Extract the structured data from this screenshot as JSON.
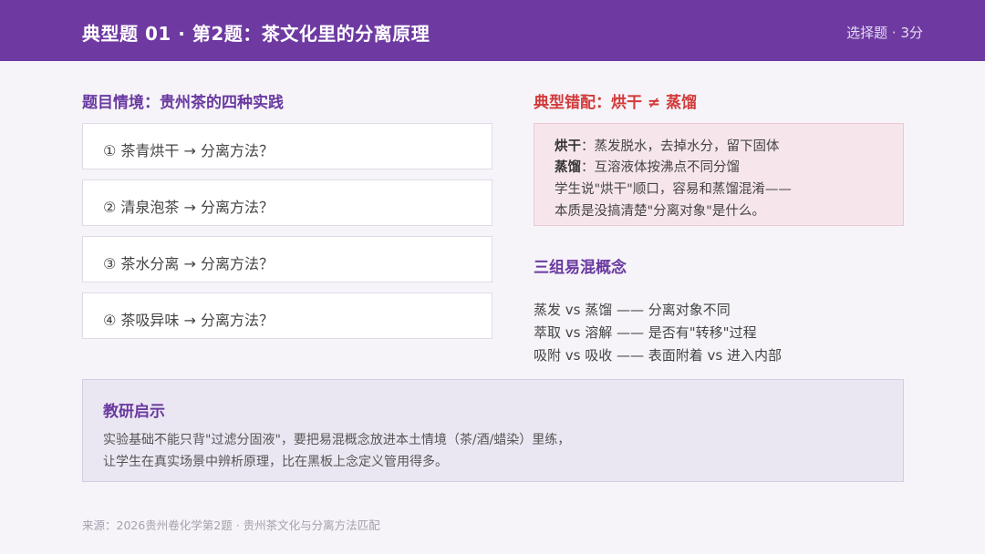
{
  "header": {
    "title": "典型题 01 · 第2题：茶文化里的分离原理",
    "meta": "选择题 · 3分"
  },
  "scenario": {
    "title": "题目情境：贵州茶的四种实践",
    "questions": [
      "① 茶青烘干 → 分离方法？",
      "② 清泉泡茶 → 分离方法？",
      "③ 茶水分离 → 分离方法？",
      "④ 茶吸异味 → 分离方法？"
    ]
  },
  "mismatch": {
    "title": "典型错配：烘干 ≠ 蒸馏",
    "lines": [
      {
        "term": "烘干",
        "text": "：蒸发脱水，去掉水分，留下固体"
      },
      {
        "term": "蒸馏",
        "text": "：互溶液体按沸点不同分馏"
      },
      {
        "term": "",
        "text": "学生说\"烘干\"顺口，容易和蒸馏混淆——"
      },
      {
        "term": "",
        "text": "本质是没搞清楚\"分离对象\"是什么。"
      }
    ]
  },
  "concepts": {
    "title": "三组易混概念",
    "items": [
      "蒸发 vs 蒸馏 —— 分离对象不同",
      "萃取 vs 溶解 —— 是否有\"转移\"过程",
      "吸附 vs 吸收 —— 表面附着 vs 进入内部"
    ]
  },
  "insight": {
    "title": "教研启示",
    "lines": [
      "实验基础不能只背\"过滤分固液\"，要把易混概念放进本土情境（茶/酒/蜡染）里练，",
      "让学生在真实场景中辨析原理，比在黑板上念定义管用得多。"
    ]
  },
  "source": "来源：2026贵州卷化学第2题 · 贵州茶文化与分离方法匹配",
  "colors": {
    "header_bg": "#6e3aa2",
    "accent_purple": "#6a3aa0",
    "accent_red": "#d23a3a"
  }
}
